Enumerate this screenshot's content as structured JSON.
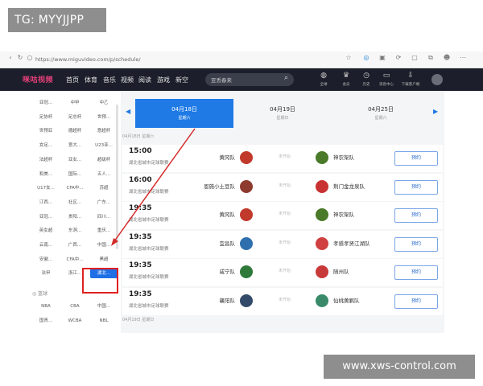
{
  "watermark": {
    "top": "TG: MYYJJPP",
    "bottom": "www.xws-control.com"
  },
  "browser": {
    "url": "https://www.miguvideo.com/p/schedule/"
  },
  "header": {
    "logo": "咪咕视频",
    "nav": [
      "首页",
      "体育",
      "音乐",
      "视频",
      "阅读",
      "游戏",
      "新空"
    ],
    "search_placeholder": "亚丢春来",
    "icons": [
      {
        "icon": "globe-icon",
        "label": "全球"
      },
      {
        "icon": "crown-icon",
        "label": "会员"
      },
      {
        "icon": "history-icon",
        "label": "历史"
      },
      {
        "icon": "message-icon",
        "label": "消息中心"
      },
      {
        "icon": "download-icon",
        "label": "下载客户端"
      }
    ]
  },
  "sidebar": {
    "rows": [
      [
        "亚冠...",
        "中甲",
        "中乙"
      ],
      [
        "足协杯",
        "足总杯",
        "世预..."
      ],
      [
        "世预亚",
        "德超杯",
        "意超杯"
      ],
      [
        "女足...",
        "意大...",
        "U23亚..."
      ],
      [
        "法超杯",
        "亚女...",
        "超级杯"
      ],
      [
        "和美...",
        "国际...",
        "五人..."
      ],
      [
        "U17女...",
        "CFA中...",
        "苏超"
      ],
      [
        "江西...",
        "社区...",
        "广东..."
      ],
      [
        "亚冠...",
        "贵阳...",
        "四川..."
      ],
      [
        "英女超",
        "东洞...",
        "重庆..."
      ],
      [
        "云南...",
        "广西...",
        "中国..."
      ],
      [
        "安徽...",
        "CFA中...",
        "黑超"
      ],
      [
        "法甲",
        "浙江...",
        "湖北..."
      ]
    ],
    "basketball_label": "篮球",
    "basketball_rows": [
      [
        "NBA",
        "CBA",
        "中国..."
      ],
      [
        "国青...",
        "WCBA",
        "NBL"
      ]
    ]
  },
  "dates": [
    {
      "date": "04月18日",
      "weekday": "星期六"
    },
    {
      "date": "04月19日",
      "weekday": "星期日"
    },
    {
      "date": "04月25日",
      "weekday": "星期六"
    }
  ],
  "section_date": "04月18日 星期六",
  "matches": [
    {
      "time": "15:00",
      "league": "湖北省城市足球联赛",
      "home": "黄冈队",
      "status": "未开始",
      "away": "神农架队",
      "button": "预约"
    },
    {
      "time": "16:00",
      "league": "湖北省城市足球联赛",
      "home": "恩施小土豆队",
      "status": "未开始",
      "away": "荆门金龙泉队",
      "button": "预约"
    },
    {
      "time": "19:35",
      "league": "湖北省城市足球联赛",
      "home": "黄冈队",
      "status": "未开始",
      "away": "神农架队",
      "button": "预约"
    },
    {
      "time": "19:35",
      "league": "湖北省城市足球联赛",
      "home": "宜昌队",
      "status": "未开始",
      "away": "孝感孝贤江湖队",
      "button": "预约"
    },
    {
      "time": "19:35",
      "league": "湖北省城市足球联赛",
      "home": "咸宁队",
      "status": "未开始",
      "away": "随州队",
      "button": "预约"
    },
    {
      "time": "19:35",
      "league": "湖北省城市足球联赛",
      "home": "襄阳队",
      "status": "未开始",
      "away": "仙桃黄鹂队",
      "button": "预约"
    }
  ],
  "next_section_date": "04月19日 星期日",
  "colors": {
    "accent": "#1f7ae5",
    "header_bg": "#1c1f2b",
    "highlight": "#e02020"
  }
}
